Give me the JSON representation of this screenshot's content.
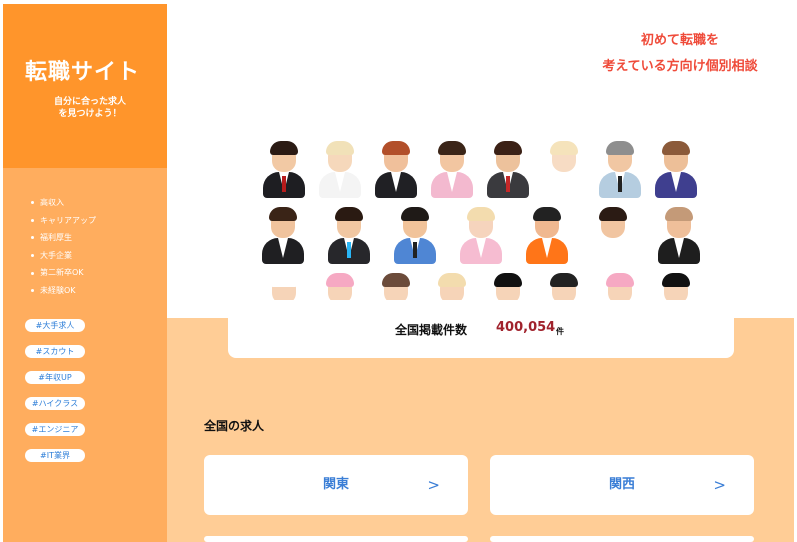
{
  "sidebar": {
    "title": "転職サイト",
    "tagline_line1": "自分に合った求人",
    "tagline_line2": "を見つけよう！",
    "features": [
      "高収入",
      "キャリアアップ",
      "福利厚生",
      "大手企業",
      "第二新卒OK",
      "未経験OK"
    ],
    "tags": [
      "#大手求人",
      "#スカウト",
      "#年収UP",
      "#ハイクラス",
      "#エンジニア",
      "#IT業界"
    ]
  },
  "header": {
    "consult_line1": "初めて転職を",
    "consult_line2": "考えている方向け個別相談"
  },
  "stats": {
    "label": "全国掲載件数",
    "count": "400,054",
    "unit": "件"
  },
  "jobs": {
    "section_title": "全国の求人",
    "regions": [
      {
        "name": "関東",
        "arrow": ">"
      },
      {
        "name": "関西",
        "arrow": ">"
      }
    ]
  },
  "colors": {
    "sidebar_head": "#ff952b",
    "sidebar_body": "#ffad5e",
    "main_orange": "#ffcd96",
    "accent_red": "#ef4b3a",
    "count_red": "#a0222c",
    "link_blue": "#3a7ed6"
  }
}
